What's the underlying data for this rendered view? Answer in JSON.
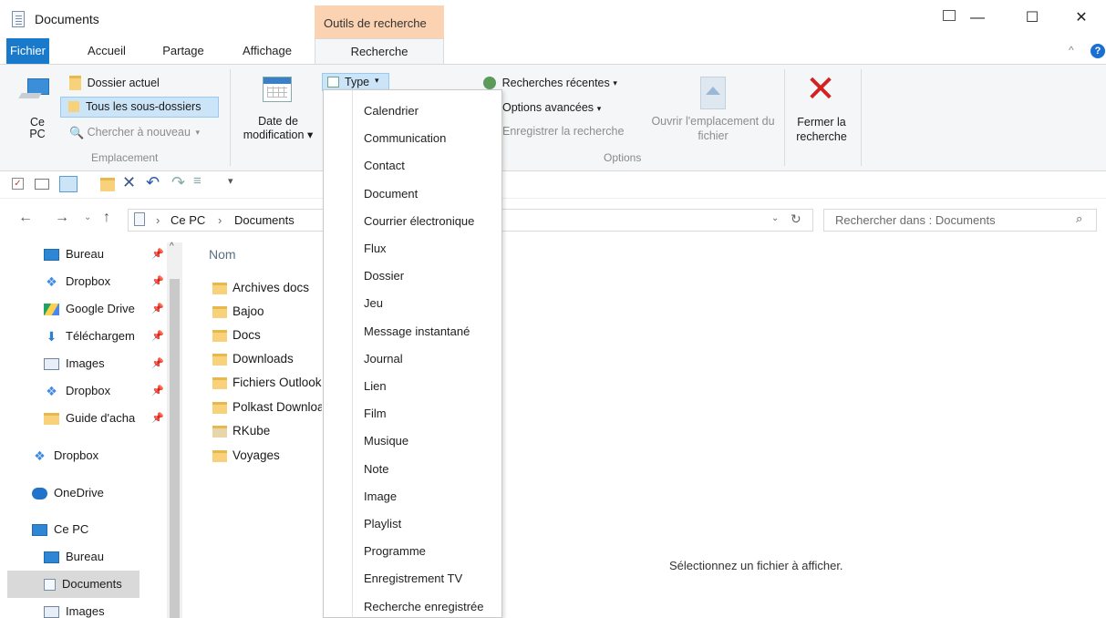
{
  "window": {
    "title": "Documents",
    "context_tab_header": "Outils de recherche",
    "controls": {
      "minimize": "—",
      "maximize": "☐",
      "close": "✕"
    }
  },
  "tabs": [
    {
      "label": "Fichier",
      "active": false
    },
    {
      "label": "Accueil",
      "active": false
    },
    {
      "label": "Partage",
      "active": false
    },
    {
      "label": "Affichage",
      "active": false
    },
    {
      "label": "Recherche",
      "active": true
    }
  ],
  "ribbon": {
    "emplacement": {
      "this_pc_label": "Ce PC",
      "dossier_actuel": "Dossier actuel",
      "tous_sous_dossiers": "Tous les sous-dossiers",
      "chercher_nouveau": "Chercher à nouveau",
      "group_label": "Emplacement"
    },
    "affiner": {
      "date_modification": "Date de modification",
      "type": "Type"
    },
    "options": {
      "recherches_recentes": "Recherches récentes",
      "options_avancees": "Options avancées",
      "enregistrer_recherche": "Enregistrer la recherche",
      "ouvrir_emplacement": "Ouvrir l'emplacement du fichier",
      "group_label": "Options"
    },
    "fermer": {
      "label": "Fermer la recherche"
    }
  },
  "address": {
    "path": [
      "Ce PC",
      "Documents"
    ],
    "search_placeholder": "Rechercher dans : Documents"
  },
  "nav": {
    "quick_access": [
      {
        "label": "Bureau",
        "icon": "desktop-icon",
        "pinned": true
      },
      {
        "label": "Dropbox",
        "icon": "dropbox-icon",
        "pinned": true
      },
      {
        "label": "Google Drive",
        "icon": "google-drive-icon",
        "pinned": true
      },
      {
        "label": "Téléchargem",
        "icon": "download-icon",
        "pinned": true
      },
      {
        "label": "Images",
        "icon": "images-icon",
        "pinned": true
      },
      {
        "label": "Dropbox",
        "icon": "dropbox-icon",
        "pinned": true
      },
      {
        "label": "Guide d'acha",
        "icon": "folder-icon",
        "pinned": true
      }
    ],
    "roots": [
      {
        "label": "Dropbox",
        "icon": "dropbox-icon"
      },
      {
        "label": "OneDrive",
        "icon": "onedrive-icon"
      },
      {
        "label": "Ce PC",
        "icon": "this-pc-icon"
      }
    ],
    "this_pc_children": [
      {
        "label": "Bureau",
        "icon": "desktop-icon",
        "selected": false
      },
      {
        "label": "Documents",
        "icon": "documents-icon",
        "selected": true
      },
      {
        "label": "Images",
        "icon": "images-icon",
        "selected": false
      }
    ]
  },
  "content": {
    "column_header": "Nom",
    "files": [
      "Archives docs",
      "Bajoo",
      "Docs",
      "Downloads",
      "Fichiers Outlook",
      "Polkast Downloads",
      "RKube",
      "Voyages"
    ],
    "preview_message": "Sélectionnez un fichier à afficher."
  },
  "type_menu": {
    "items": [
      "Calendrier",
      "Communication",
      "Contact",
      "Document",
      "Courrier électronique",
      "Flux",
      "Dossier",
      "Jeu",
      "Message instantané",
      "Journal",
      "Lien",
      "Film",
      "Musique",
      "Note",
      "Image",
      "Playlist",
      "Programme",
      "Enregistrement TV",
      "Recherche enregistrée"
    ]
  }
}
